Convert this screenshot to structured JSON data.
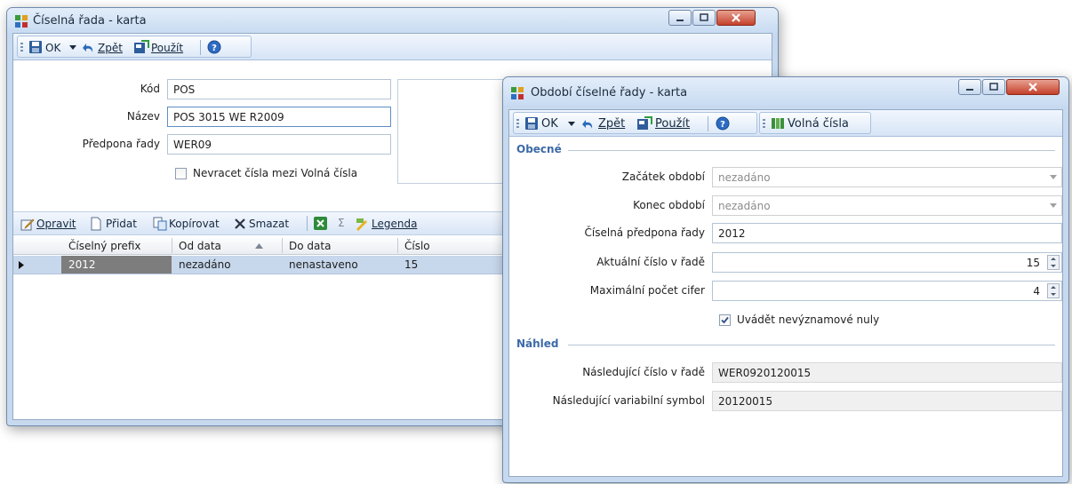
{
  "win1": {
    "title": "Číselná řada - karta",
    "toolbar": {
      "ok": "OK",
      "back": "Zpět",
      "apply": "Použít"
    },
    "form": {
      "kod_label": "Kód",
      "kod_value": "POS",
      "nazev_label": "Název",
      "nazev_value": "POS 3015 WE R2009",
      "prefix_label": "Předpona řady",
      "prefix_value": "WER09",
      "nevracet_label": "Nevracet čísla mezi Volná čísla"
    },
    "grid_toolbar": {
      "edit": "Opravit",
      "add": "Přidat",
      "copy": "Kopírovat",
      "delete": "Smazat",
      "sum": "Σ",
      "legend": "Legenda"
    },
    "grid": {
      "columns": [
        "Číselný prefix",
        "Od data",
        "Do data",
        "Číslo"
      ],
      "rows": [
        [
          "2012",
          "nezadáno",
          "nenastaveno",
          "15"
        ]
      ]
    }
  },
  "win2": {
    "title": "Období číselné řady - karta",
    "toolbar": {
      "ok": "OK",
      "back": "Zpět",
      "apply": "Použít",
      "free_numbers": "Volná čísla"
    },
    "general": {
      "title": "Obecné",
      "start_label": "Začátek období",
      "start_value": "nezadáno",
      "end_label": "Konec období",
      "end_value": "nezadáno",
      "prefix_label": "Číselná předpona řady",
      "prefix_value": "2012",
      "current_label": "Aktuální číslo v řadě",
      "current_value": "15",
      "maxdigits_label": "Maximální počet cifer",
      "maxdigits_value": "4",
      "zeros_label": "Uvádět nevýznamové nuly"
    },
    "preview": {
      "title": "Náhled",
      "next_label": "Následující číslo v řadě",
      "next_value": "WER0920120015",
      "vs_label": "Následující variabilní symbol",
      "vs_value": "20120015"
    }
  }
}
